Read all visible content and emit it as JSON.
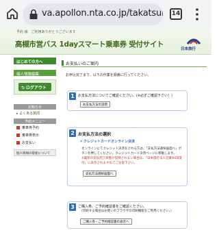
{
  "browser": {
    "url": "va.apollon.nta.co.jp/takatsuki/k",
    "tab_count": "14"
  },
  "header": {
    "user": "予約 様　ご利用ありがとうございます",
    "title": "高槻市営バス 1dayスマート乗車券 受付サイト",
    "logo_text": "日本旅行"
  },
  "sidebar": {
    "head": "はじめての方へ",
    "personal": "個人情報編集",
    "logout": "ログアウト",
    "section_help": "お知らせ",
    "faq": "よくある質問",
    "section_menu": "予約メニュー",
    "items": [
      "乗車券予約",
      "乗車券表示",
      "お支払い"
    ],
    "bottom": "個人情報の取扱について"
  },
  "main": {
    "title": "お支払いのご案内",
    "intro": "お申込完了まで、以下の作業を順番に行ってください。"
  },
  "steps": [
    {
      "num": "1",
      "title": "お支払方法についてご確認ください。(※必ずご確認下さい！)",
      "button": "お支払方法の説明"
    },
    {
      "num": "2",
      "title": "お支払方法の選択",
      "subtitle": "クレジットカードオンライン決済",
      "body1": "オンラインにてクレジット決済をされる方は、「支払方法選択画面へ」ボタンを押してください。クレジットカード決済ページに移動します。",
      "body2": "※最新の支払完了状態が反映されない場合は、「日本旅行法人営業WEB受付」に表示されますのでご注意下さい。",
      "button": "支払方法選択画面へ"
    },
    {
      "num": "3",
      "title": "ご購入券、ご予約確認書をご確認ください。",
      "body": "(印刷する場合はお使いのブラウザの印刷機能をご利用ください。)",
      "button": "ご購入券・ご予約確認書の表示へ"
    }
  ],
  "colors": {
    "brand_green": "#3f8b2c",
    "step_blue": "#2c6db5"
  }
}
